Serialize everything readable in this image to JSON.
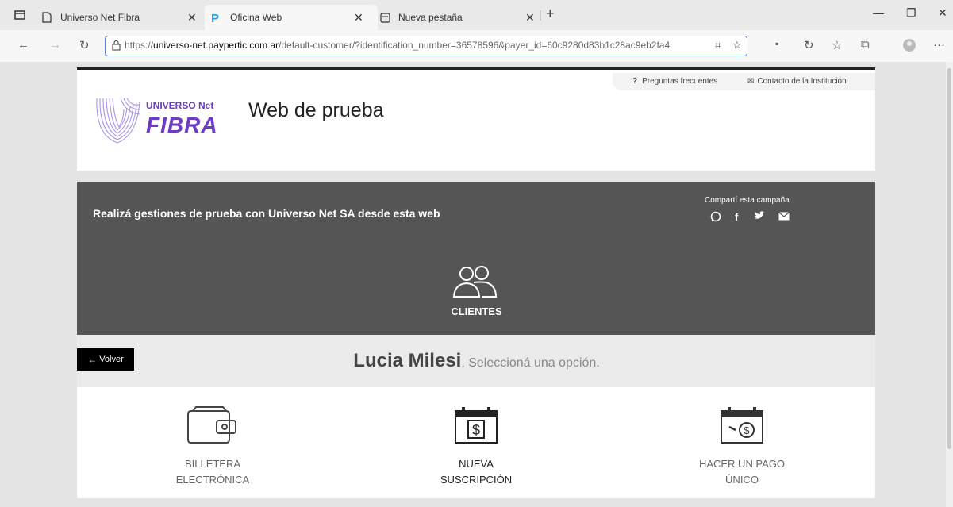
{
  "browser": {
    "tabs": [
      {
        "label": "Universo Net Fibra",
        "icon": "page-icon"
      },
      {
        "label": "Oficina Web",
        "icon": "paypertic-icon"
      },
      {
        "label": "Nueva pestaña",
        "icon": "new-tab-icon"
      }
    ],
    "url_prefix": "https://",
    "url_host": "universo-net.paypertic.com.ar",
    "url_path": "/default-customer/?identification_number=36578596&payer_id=60c9280d83b1c28ac9eb2fa4"
  },
  "header": {
    "faq_label": "Preguntas frecuentes",
    "contact_label": "Contacto de la Institución",
    "brand_top": "UNIVERSO Net",
    "brand_bottom": "FIBRA",
    "title": "Web de prueba"
  },
  "banner": {
    "text": "Realizá gestiones de prueba con Universo Net SA desde esta web",
    "share_label": "Compartí esta campaña",
    "share_icons": [
      "whatsapp-icon",
      "facebook-icon",
      "twitter-icon",
      "email-icon"
    ],
    "section_label": "CLIENTES"
  },
  "greeting": {
    "back_label": "Volver",
    "name": "Lucia Milesi",
    "prompt": ", Seleccioná una opción."
  },
  "options": [
    {
      "line1": "BILLETERA",
      "line2": "ELECTRÓNICA",
      "icon": "wallet-icon",
      "color": "#666666"
    },
    {
      "line1": "NUEVA",
      "line2": "SUSCRIPCIÓN",
      "icon": "calendar-dollar-icon",
      "color": "#222222"
    },
    {
      "line1": "HACER UN PAGO",
      "line2": "ÚNICO",
      "icon": "calendar-coin-icon",
      "color": "#666666"
    }
  ],
  "colors": {
    "brand_purple": "#6d3cc4",
    "banner_gray": "#555555",
    "back_button": "#000000"
  }
}
